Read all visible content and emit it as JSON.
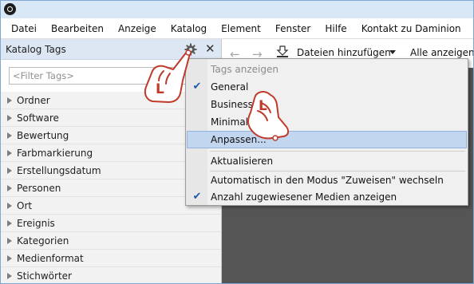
{
  "menubar": {
    "items": [
      "Datei",
      "Bearbeiten",
      "Anzeige",
      "Katalog",
      "Element",
      "Fenster",
      "Hilfe",
      "Kontakt zu Daminion"
    ]
  },
  "left_panel": {
    "title": "Katalog Tags",
    "filter_placeholder": "<Filter Tags>",
    "close_glyph": "✕",
    "tags": [
      "Ordner",
      "Software",
      "Bewertung",
      "Farbmarkierung",
      "Erstellungsdatum",
      "Personen",
      "Ort",
      "Ereignis",
      "Kategorien",
      "Medienformat",
      "Stichwörter"
    ]
  },
  "toolbar": {
    "add_files_label": "Dateien hinzufügen",
    "show_all_label": "Alle anzeigen"
  },
  "context_menu": {
    "header": "Tags anzeigen",
    "general": "General",
    "business": "Business",
    "minimal": "Minimal",
    "customize": "Anpassen...",
    "refresh": "Aktualisieren",
    "auto_assign": "Automatisch in den Modus \"Zuweisen\" wechseln",
    "show_count": "Anzahl zugewiesener Medien anzeigen",
    "checked_items": [
      "General",
      "Anzahl zugewiesener Medien anzeigen"
    ]
  },
  "cursors": {
    "letter": "L",
    "color": "#c0392b"
  }
}
